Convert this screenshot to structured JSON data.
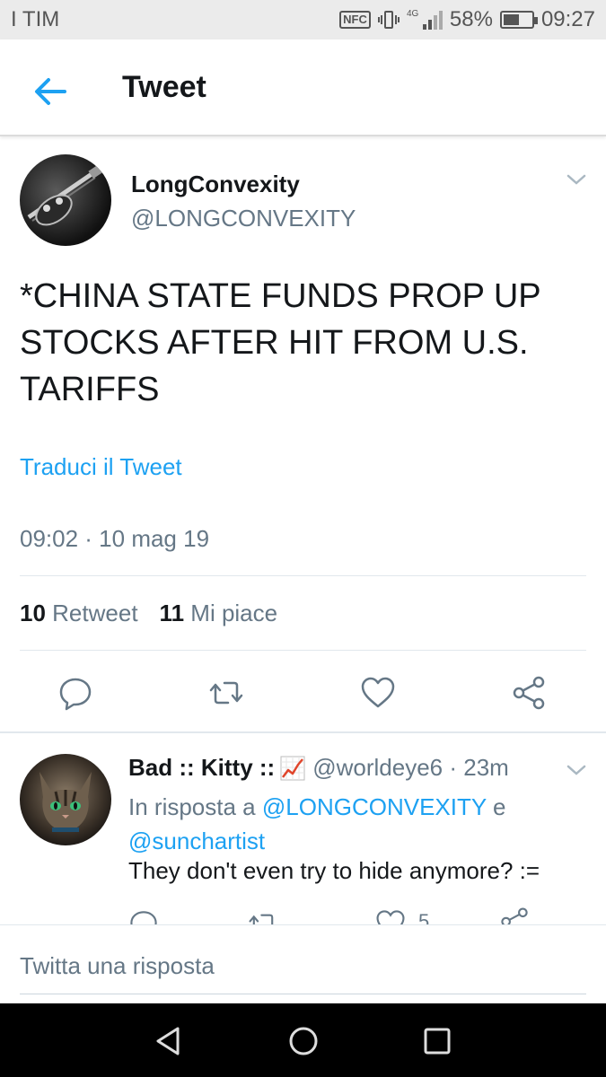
{
  "status_bar": {
    "carrier": "I TIM",
    "nfc_label": "NFC",
    "network": "4G",
    "battery_percent": "58%",
    "battery_level": 0.58,
    "time": "09:27"
  },
  "app_bar": {
    "title": "Tweet",
    "back_icon": "arrow-left-icon"
  },
  "tweet": {
    "display_name": "LongConvexity",
    "handle": "@LONGCONVEXITY",
    "text": "*CHINA STATE FUNDS PROP UP STOCKS AFTER HIT FROM U.S. TARIFFS",
    "translate_label": "Traduci il Tweet",
    "timestamp": "09:02 · 10 mag 19",
    "retweet_count": "10",
    "retweet_label": "Retweet",
    "like_count": "11",
    "like_label": "Mi piace",
    "actions": [
      "reply-icon",
      "retweet-icon",
      "heart-icon",
      "share-icon"
    ]
  },
  "reply": {
    "display_name": "Bad :: Kitty ::",
    "emoji": "chart-increasing-emoji",
    "handle": "@worldeye6",
    "separator": "·",
    "time_ago": "23m",
    "context_prefix": "In risposta a",
    "mention_1": "@LONGCONVEXITY",
    "context_joiner": "e",
    "mention_2": "@sunchartist",
    "text": "They don't even try to hide anymore? :=",
    "like_count": "5"
  },
  "compose": {
    "placeholder": "Twitta una risposta"
  },
  "colors": {
    "accent": "#1da1f2",
    "secondary_text": "#657786",
    "primary_text": "#14171a",
    "status_bar_bg": "#ebebeb",
    "nav_bar_bg": "#000000"
  }
}
